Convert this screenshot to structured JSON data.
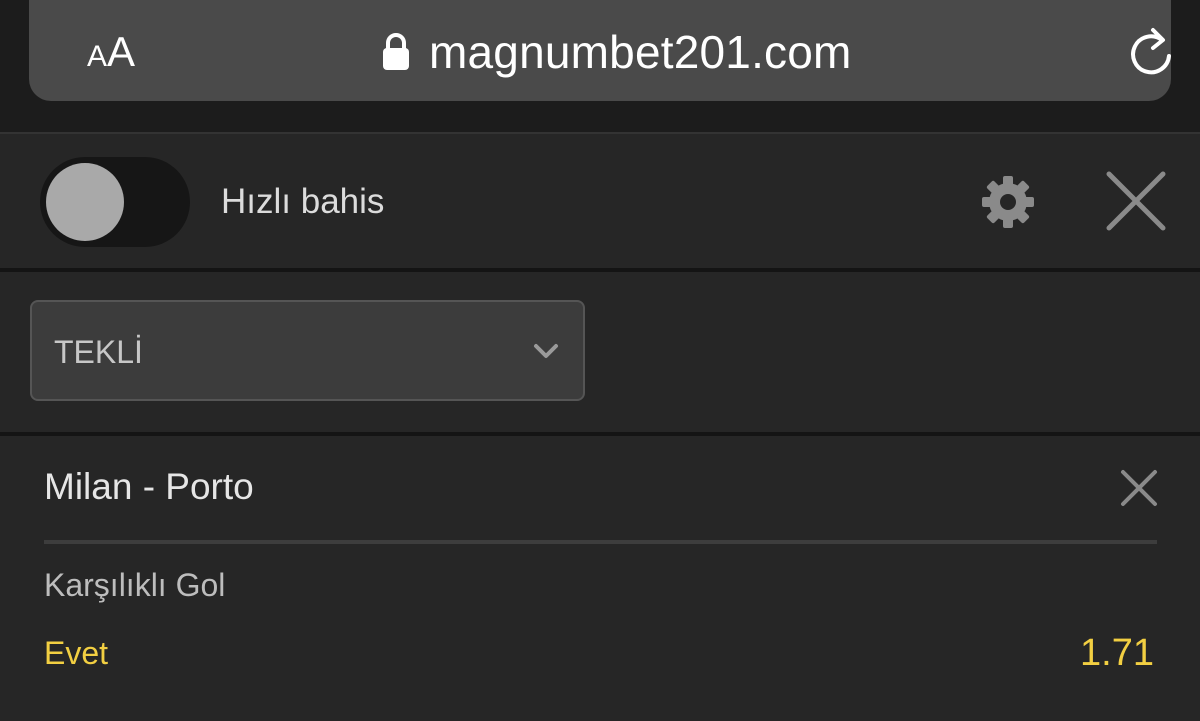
{
  "browser": {
    "text_size_small": "A",
    "text_size_big": "A",
    "url": "magnumbet201.com"
  },
  "header": {
    "quick_bet_label": "Hızlı bahis",
    "quick_bet_enabled": false
  },
  "bet_type": {
    "selected": "TEKLİ"
  },
  "bet": {
    "match": "Milan - Porto",
    "market": "Karşılıklı Gol",
    "selection": "Evet",
    "odds": "1.71"
  },
  "icons": {
    "lock": "lock-icon",
    "reload": "reload-icon",
    "settings": "gear-icon",
    "close": "close-icon",
    "dropdown": "chevron-down-icon"
  },
  "colors": {
    "background": "#262626",
    "accent": "#f2cf42",
    "url_bar": "#4a4a4a"
  }
}
